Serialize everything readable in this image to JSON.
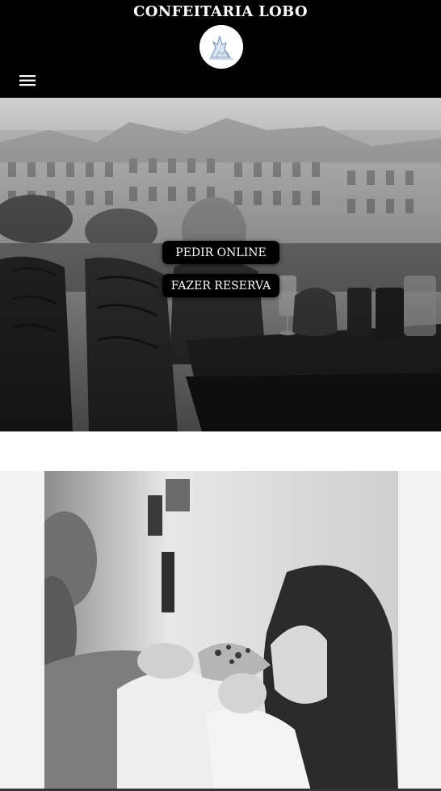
{
  "header": {
    "brand": "CONFEITARIA LOBO",
    "logo_icon": "wolf-logo-icon",
    "menu_icon": "hamburger-menu-icon"
  },
  "hero": {
    "order_online_label": "PEDIR ONLINE",
    "reservation_label": "FAZER RESERVA"
  },
  "colors": {
    "header_bg": "#000000",
    "button_bg": "#000000",
    "gallery_bg": "#f2f2f2"
  }
}
